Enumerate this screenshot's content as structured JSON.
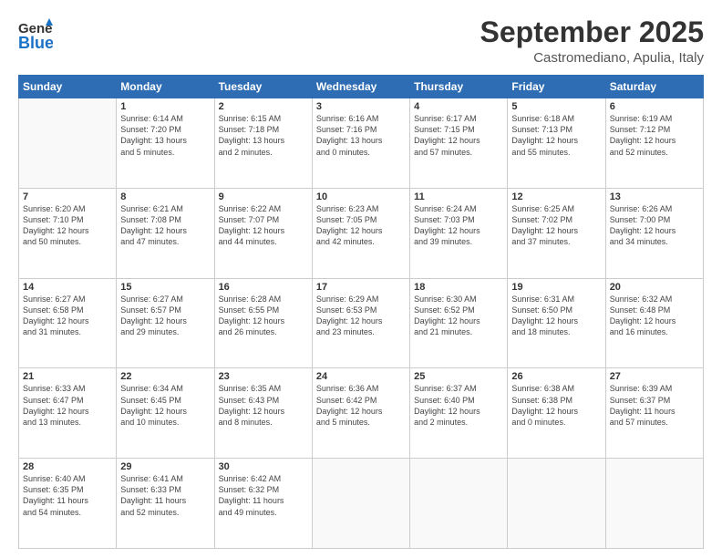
{
  "header": {
    "logo_general": "General",
    "logo_blue": "Blue",
    "month": "September 2025",
    "location": "Castromediano, Apulia, Italy"
  },
  "columns": [
    "Sunday",
    "Monday",
    "Tuesday",
    "Wednesday",
    "Thursday",
    "Friday",
    "Saturday"
  ],
  "weeks": [
    [
      {
        "day": "",
        "info": ""
      },
      {
        "day": "1",
        "info": "Sunrise: 6:14 AM\nSunset: 7:20 PM\nDaylight: 13 hours\nand 5 minutes."
      },
      {
        "day": "2",
        "info": "Sunrise: 6:15 AM\nSunset: 7:18 PM\nDaylight: 13 hours\nand 2 minutes."
      },
      {
        "day": "3",
        "info": "Sunrise: 6:16 AM\nSunset: 7:16 PM\nDaylight: 13 hours\nand 0 minutes."
      },
      {
        "day": "4",
        "info": "Sunrise: 6:17 AM\nSunset: 7:15 PM\nDaylight: 12 hours\nand 57 minutes."
      },
      {
        "day": "5",
        "info": "Sunrise: 6:18 AM\nSunset: 7:13 PM\nDaylight: 12 hours\nand 55 minutes."
      },
      {
        "day": "6",
        "info": "Sunrise: 6:19 AM\nSunset: 7:12 PM\nDaylight: 12 hours\nand 52 minutes."
      }
    ],
    [
      {
        "day": "7",
        "info": "Sunrise: 6:20 AM\nSunset: 7:10 PM\nDaylight: 12 hours\nand 50 minutes."
      },
      {
        "day": "8",
        "info": "Sunrise: 6:21 AM\nSunset: 7:08 PM\nDaylight: 12 hours\nand 47 minutes."
      },
      {
        "day": "9",
        "info": "Sunrise: 6:22 AM\nSunset: 7:07 PM\nDaylight: 12 hours\nand 44 minutes."
      },
      {
        "day": "10",
        "info": "Sunrise: 6:23 AM\nSunset: 7:05 PM\nDaylight: 12 hours\nand 42 minutes."
      },
      {
        "day": "11",
        "info": "Sunrise: 6:24 AM\nSunset: 7:03 PM\nDaylight: 12 hours\nand 39 minutes."
      },
      {
        "day": "12",
        "info": "Sunrise: 6:25 AM\nSunset: 7:02 PM\nDaylight: 12 hours\nand 37 minutes."
      },
      {
        "day": "13",
        "info": "Sunrise: 6:26 AM\nSunset: 7:00 PM\nDaylight: 12 hours\nand 34 minutes."
      }
    ],
    [
      {
        "day": "14",
        "info": "Sunrise: 6:27 AM\nSunset: 6:58 PM\nDaylight: 12 hours\nand 31 minutes."
      },
      {
        "day": "15",
        "info": "Sunrise: 6:27 AM\nSunset: 6:57 PM\nDaylight: 12 hours\nand 29 minutes."
      },
      {
        "day": "16",
        "info": "Sunrise: 6:28 AM\nSunset: 6:55 PM\nDaylight: 12 hours\nand 26 minutes."
      },
      {
        "day": "17",
        "info": "Sunrise: 6:29 AM\nSunset: 6:53 PM\nDaylight: 12 hours\nand 23 minutes."
      },
      {
        "day": "18",
        "info": "Sunrise: 6:30 AM\nSunset: 6:52 PM\nDaylight: 12 hours\nand 21 minutes."
      },
      {
        "day": "19",
        "info": "Sunrise: 6:31 AM\nSunset: 6:50 PM\nDaylight: 12 hours\nand 18 minutes."
      },
      {
        "day": "20",
        "info": "Sunrise: 6:32 AM\nSunset: 6:48 PM\nDaylight: 12 hours\nand 16 minutes."
      }
    ],
    [
      {
        "day": "21",
        "info": "Sunrise: 6:33 AM\nSunset: 6:47 PM\nDaylight: 12 hours\nand 13 minutes."
      },
      {
        "day": "22",
        "info": "Sunrise: 6:34 AM\nSunset: 6:45 PM\nDaylight: 12 hours\nand 10 minutes."
      },
      {
        "day": "23",
        "info": "Sunrise: 6:35 AM\nSunset: 6:43 PM\nDaylight: 12 hours\nand 8 minutes."
      },
      {
        "day": "24",
        "info": "Sunrise: 6:36 AM\nSunset: 6:42 PM\nDaylight: 12 hours\nand 5 minutes."
      },
      {
        "day": "25",
        "info": "Sunrise: 6:37 AM\nSunset: 6:40 PM\nDaylight: 12 hours\nand 2 minutes."
      },
      {
        "day": "26",
        "info": "Sunrise: 6:38 AM\nSunset: 6:38 PM\nDaylight: 12 hours\nand 0 minutes."
      },
      {
        "day": "27",
        "info": "Sunrise: 6:39 AM\nSunset: 6:37 PM\nDaylight: 11 hours\nand 57 minutes."
      }
    ],
    [
      {
        "day": "28",
        "info": "Sunrise: 6:40 AM\nSunset: 6:35 PM\nDaylight: 11 hours\nand 54 minutes."
      },
      {
        "day": "29",
        "info": "Sunrise: 6:41 AM\nSunset: 6:33 PM\nDaylight: 11 hours\nand 52 minutes."
      },
      {
        "day": "30",
        "info": "Sunrise: 6:42 AM\nSunset: 6:32 PM\nDaylight: 11 hours\nand 49 minutes."
      },
      {
        "day": "",
        "info": ""
      },
      {
        "day": "",
        "info": ""
      },
      {
        "day": "",
        "info": ""
      },
      {
        "day": "",
        "info": ""
      }
    ]
  ]
}
